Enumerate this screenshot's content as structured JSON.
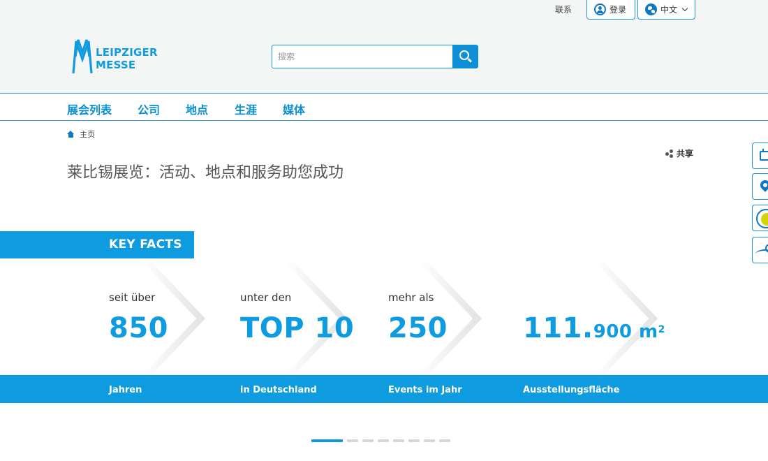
{
  "topbar": {
    "contact": "联系",
    "login": "登录",
    "language": "中文"
  },
  "logo": {
    "line1": "LEIPZIGER",
    "line2": "MESSE"
  },
  "search": {
    "placeholder": "搜索"
  },
  "nav": {
    "items": [
      {
        "label": "展会列表"
      },
      {
        "label": "公司"
      },
      {
        "label": "地点"
      },
      {
        "label": "生涯"
      },
      {
        "label": "媒体"
      }
    ]
  },
  "breadcrumb": {
    "home": "主页"
  },
  "share": {
    "label": "共享"
  },
  "page": {
    "title": "莱比锡展览：活动、地点和服务助您成功"
  },
  "key_facts": {
    "label": "KEY FACTS",
    "facts": [
      {
        "pre": "seit über",
        "value": "850",
        "post": "Jahren"
      },
      {
        "pre": "unter den",
        "value": "TOP 10",
        "post": "in Deutschland"
      },
      {
        "pre": "mehr als",
        "value": "250",
        "post": "Events im Jahr"
      },
      {
        "pre": "",
        "value_main": "111.",
        "value_small": "900 m",
        "value_sup": "2",
        "post": "Ausstellungsfläche"
      }
    ]
  },
  "carousel": {
    "active_index": 0,
    "count": 8
  },
  "side_tools": [
    {
      "icon": "calendar-icon"
    },
    {
      "icon": "location-pin-icon"
    },
    {
      "icon": "sustainability-icon"
    },
    {
      "icon": "map-icon"
    }
  ],
  "colors": {
    "brand_blue": "#0e9be0",
    "nav_blue": "#0b8fd2",
    "border_blue": "#1a93d4"
  }
}
